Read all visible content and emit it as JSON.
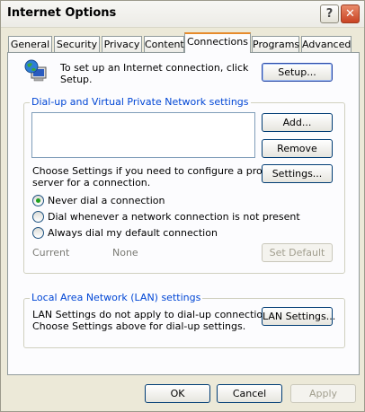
{
  "window": {
    "title": "Internet Options",
    "help_glyph": "?",
    "close_glyph": "✕"
  },
  "tabs": [
    "General",
    "Security",
    "Privacy",
    "Content",
    "Connections",
    "Programs",
    "Advanced"
  ],
  "setup": {
    "text_line1": "To set up an Internet connection, click",
    "text_line2": "Setup.",
    "button": "Setup..."
  },
  "dialup": {
    "group_label": "Dial-up and Virtual Private Network settings",
    "add_button": "Add...",
    "remove_button": "Remove",
    "settings_button": "Settings...",
    "choose_line1": "Choose Settings if you need to configure a proxy",
    "choose_line2": "server for a connection.",
    "radio_never": "Never dial a connection",
    "radio_whenever": "Dial whenever a network connection is not present",
    "radio_always": "Always dial my default connection",
    "selected_radio": "Never dial a connection",
    "current_label": "Current",
    "current_value": "None",
    "set_default_button": "Set Default"
  },
  "lan": {
    "group_label": "Local Area Network (LAN) settings",
    "text_line1": "LAN Settings do not apply to dial-up connections.",
    "text_line2": "Choose Settings above for dial-up settings.",
    "button": "LAN Settings..."
  },
  "footer": {
    "ok": "OK",
    "cancel": "Cancel",
    "apply": "Apply"
  },
  "icons": {
    "globe": "globe-computer-icon"
  }
}
